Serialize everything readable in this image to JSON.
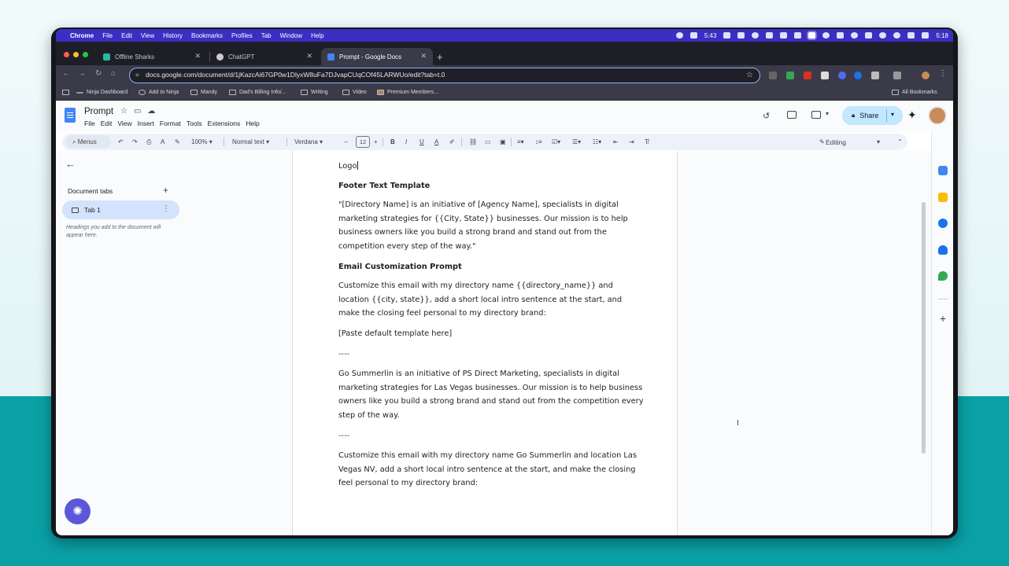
{
  "menubar": {
    "app": "Chrome",
    "items": [
      "File",
      "Edit",
      "View",
      "History",
      "Bookmarks",
      "Profiles",
      "Tab",
      "Window",
      "Help"
    ],
    "timer": "5:43",
    "clock": "5:18"
  },
  "tabs": [
    {
      "title": "Offline Sharks",
      "color": "#2bb5a3",
      "active": false
    },
    {
      "title": "ChatGPT",
      "color": "#cccccc",
      "active": false
    },
    {
      "title": "Prompt - Google Docs",
      "color": "#4285f4",
      "active": true
    }
  ],
  "address": {
    "url": "docs.google.com/document/d/1jKazcAi67GP0w1DlyxW8uFa7DJvapCUqCOf45LARWUo/edit?tab=t.0"
  },
  "bookmarks": {
    "items": [
      "Ninja Dashboard",
      "Add to Ninja",
      "Mandy",
      "Dad's Billing Info/...",
      "Writing",
      "Video",
      "Premium Members..."
    ],
    "all": "All Bookmarks"
  },
  "docs": {
    "title": "Prompt",
    "menu": [
      "File",
      "Edit",
      "View",
      "Insert",
      "Format",
      "Tools",
      "Extensions",
      "Help"
    ],
    "share_label": "Share",
    "brand_color": "#4285f4"
  },
  "toolbar": {
    "menus": "Menus",
    "zoom": "100%",
    "style": "Normal text",
    "font": "Verdana",
    "size": "12",
    "mode": "Editing"
  },
  "sidebar": {
    "heading": "Document tabs",
    "tab": "Tab 1",
    "hint": "Headings you add to the document will appear here."
  },
  "document": {
    "logo": "Logo",
    "footer_heading": "Footer Text Template",
    "footer_text": "\"[Directory Name] is an initiative of [Agency Name], specialists in digital marketing strategies for {{City, State}} businesses. Our mission is to help business owners like you build a strong brand and stand out from the competition every step of the way.\"",
    "email_heading": "Email Customization Prompt",
    "email_prompt": "Customize this email with my directory name {{directory_name}} and location {{city, state}}, add a short local intro sentence at the start, and make the closing feel personal to my directory brand:",
    "paste": "[Paste default template here]",
    "divider": "----",
    "example_text": "Go Summerlin is an initiative of PS Direct Marketing, specialists in digital marketing strategies for Las Vegas businesses. Our mission is to help business owners like you build a strong brand and stand out from the competition every step of the way.",
    "example_prompt": "Customize this email with my directory name Go Summerlin and location Las Vegas NV, add a short local intro sentence at the start, and make the closing feel personal to my directory brand:"
  }
}
